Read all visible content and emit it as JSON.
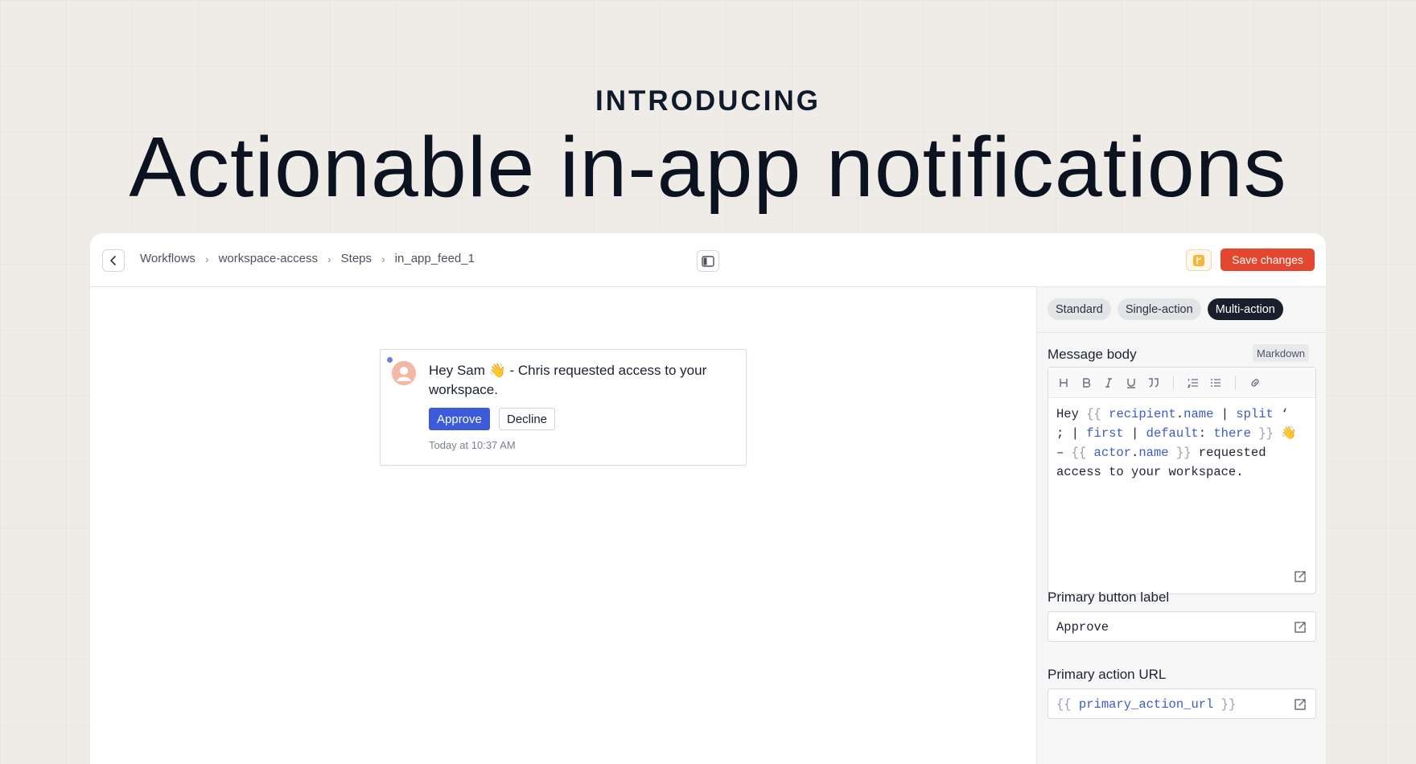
{
  "hero": {
    "eyebrow": "INTRODUCING",
    "headline": "Actionable in-app notifications"
  },
  "topbar": {
    "breadcrumbs": [
      "Workflows",
      "workspace-access",
      "Steps",
      "in_app_feed_1"
    ],
    "save_label": "Save changes"
  },
  "notification": {
    "message": "Hey Sam 👋 - Chris requested access to your workspace.",
    "approve_label": "Approve",
    "decline_label": "Decline",
    "timestamp": "Today at 10:37 AM"
  },
  "sidebar": {
    "tabs": [
      {
        "label": "Standard",
        "active": false
      },
      {
        "label": "Single-action",
        "active": false
      },
      {
        "label": "Multi-action",
        "active": true
      }
    ],
    "message_body": {
      "label": "Message body",
      "format_badge": "Markdown",
      "toolbar": [
        "heading-icon",
        "bold-icon",
        "italic-icon",
        "underline-icon",
        "quote-icon",
        "ordered-list-icon",
        "bullet-list-icon",
        "link-icon"
      ]
    },
    "primary_button": {
      "label": "Primary button label",
      "value": "Approve"
    },
    "primary_url": {
      "label": "Primary action URL",
      "value": "{{ primary_action_url }}"
    }
  },
  "colors": {
    "accent": "#e4472f",
    "approve": "#3b5bdb",
    "active_tab": "#1a202b",
    "template_var": "#3d5bc6"
  }
}
